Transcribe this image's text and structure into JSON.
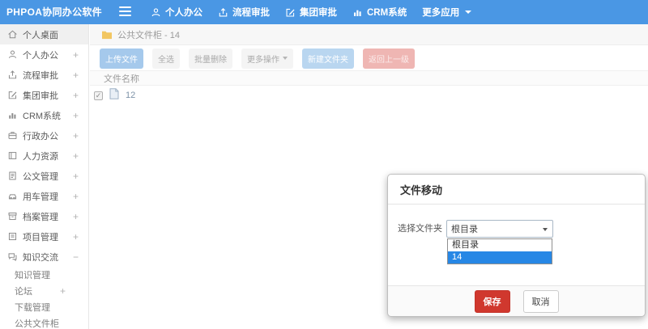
{
  "navbar": {
    "brand": "PHPOA协同办公软件",
    "items": [
      {
        "label": "个人办公"
      },
      {
        "label": "流程审批"
      },
      {
        "label": "集团审批"
      },
      {
        "label": "CRM系统"
      },
      {
        "label": "更多应用"
      }
    ]
  },
  "sidebar": {
    "items": [
      {
        "label": "个人桌面",
        "expand": ""
      },
      {
        "label": "个人办公",
        "expand": "+"
      },
      {
        "label": "流程审批",
        "expand": "+"
      },
      {
        "label": "集团审批",
        "expand": "+"
      },
      {
        "label": "CRM系统",
        "expand": "+"
      },
      {
        "label": "行政办公",
        "expand": "+"
      },
      {
        "label": "人力资源",
        "expand": "+"
      },
      {
        "label": "公文管理",
        "expand": "+"
      },
      {
        "label": "用车管理",
        "expand": "+"
      },
      {
        "label": "档案管理",
        "expand": "+"
      },
      {
        "label": "项目管理",
        "expand": "+"
      },
      {
        "label": "知识交流",
        "expand": "−"
      }
    ],
    "subitems": [
      {
        "label": "知识管理",
        "expand": ""
      },
      {
        "label": "论坛",
        "expand": "+"
      },
      {
        "label": "下载管理",
        "expand": ""
      },
      {
        "label": "公共文件柜",
        "expand": ""
      }
    ]
  },
  "breadcrumb": {
    "text": "公共文件柜 - 14"
  },
  "toolbar": {
    "upload": "上传文件",
    "select_all": "全选",
    "batch_delete": "批量删除",
    "more_ops": "更多操作",
    "new_folder": "新建文件夹",
    "go_back": "返回上一级"
  },
  "table": {
    "name_header": "文件名称",
    "rows": [
      {
        "name": "12",
        "checked": "✓"
      }
    ]
  },
  "modal": {
    "title": "文件移动",
    "field_label": "选择文件夹",
    "select_value": "根目录",
    "options": [
      {
        "label": "根目录",
        "highlighted": false
      },
      {
        "label": "14",
        "highlighted": true
      }
    ],
    "save_label": "保存",
    "cancel_label": "取消"
  },
  "colors": {
    "navbar_blue": "#4a97e4",
    "option_highlight": "#2787e5",
    "save_red": "#d0382e",
    "upload_btn": "#a5c9ec",
    "newfolder_btn": "#b9d6f0",
    "back_btn": "#efb6b3",
    "folder_yellow": "#f2c661"
  }
}
